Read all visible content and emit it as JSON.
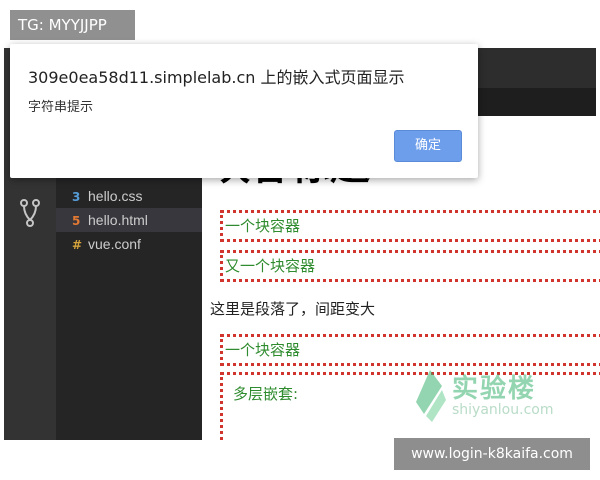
{
  "watermark": {
    "tg_label": "TG: MYYJJPP",
    "url_label": "www.login-k8kaifa.com",
    "logo_cn": "实验楼",
    "logo_en": "shiyanlou.com"
  },
  "dialog": {
    "title": "309e0ea58d11.simplelab.cn 上的嵌入式页面显示",
    "message": "字符串提示",
    "ok_label": "确定"
  },
  "explorer": {
    "files": [
      {
        "name": "hello.css",
        "icon": "css-file-icon",
        "icon_glyph": "3",
        "icon_color": "#569cd6"
      },
      {
        "name": "hello.html",
        "icon": "html-file-icon",
        "icon_glyph": "5",
        "icon_color": "#e37933",
        "active": true
      },
      {
        "name": "vue.conf",
        "icon": "config-file-icon",
        "icon_glyph": "#",
        "icon_color": "#d4a23a"
      }
    ]
  },
  "preview": {
    "heading": "块容标题",
    "box1": "一个块容器",
    "box2": "又一个块容器",
    "paragraph": "这里是段落了，间距变大",
    "box3": "一个块容器",
    "nested": "多层嵌套:"
  },
  "colors": {
    "box_border": "#d0342c",
    "box_text": "#2e8b2e",
    "ok_button": "#6d9eeb"
  }
}
